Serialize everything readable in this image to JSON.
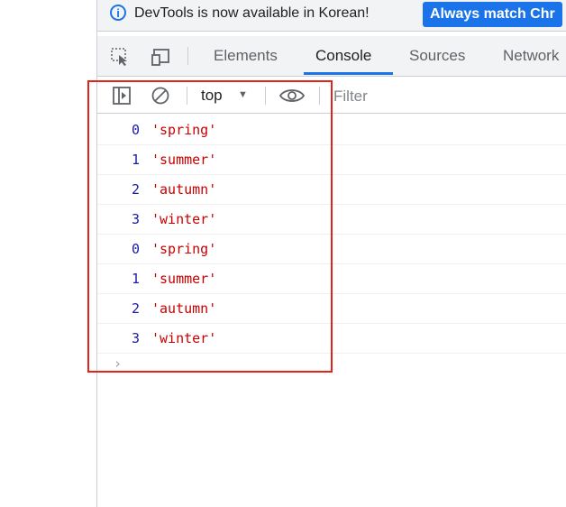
{
  "infobar": {
    "message": "DevTools is now available in Korean!",
    "button_label": "Always match Chr"
  },
  "tabs": [
    {
      "label": "Elements",
      "active": false
    },
    {
      "label": "Console",
      "active": true
    },
    {
      "label": "Sources",
      "active": false
    },
    {
      "label": "Network",
      "active": false
    }
  ],
  "console_toolbar": {
    "context": "top",
    "filter_placeholder": "Filter"
  },
  "messages": [
    {
      "index": "0",
      "value": "'spring'"
    },
    {
      "index": "1",
      "value": "'summer'"
    },
    {
      "index": "2",
      "value": "'autumn'"
    },
    {
      "index": "3",
      "value": "'winter'"
    },
    {
      "index": "0",
      "value": "'spring'"
    },
    {
      "index": "1",
      "value": "'summer'"
    },
    {
      "index": "2",
      "value": "'autumn'"
    },
    {
      "index": "3",
      "value": "'winter'"
    }
  ],
  "colors": {
    "accent": "#1a73e8",
    "number": "#1a1aa6",
    "string": "#c80000",
    "highlight": "#e2231a"
  }
}
